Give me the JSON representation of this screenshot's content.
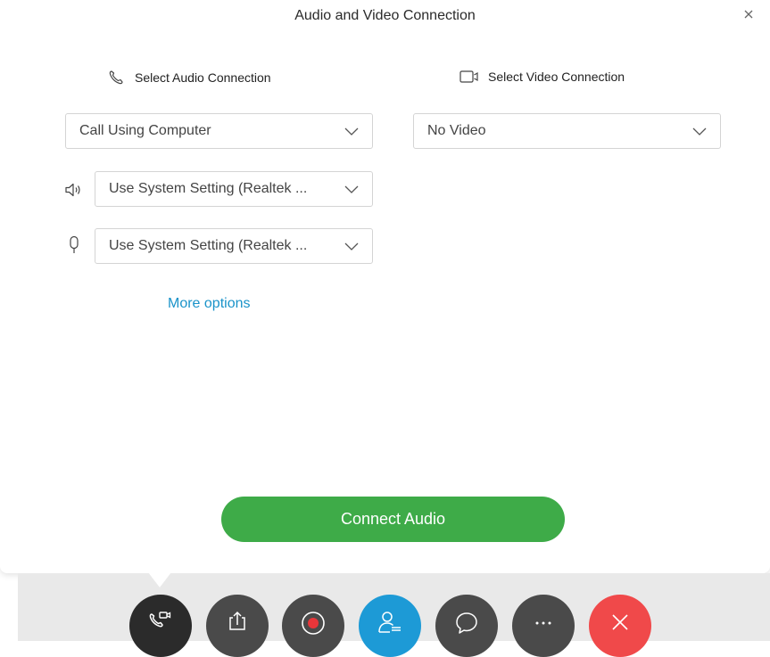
{
  "dialog": {
    "title": "Audio and Video Connection"
  },
  "audio": {
    "heading": "Select Audio Connection",
    "connection_value": "Call Using Computer",
    "speaker_value": "Use System Setting (Realtek ...",
    "microphone_value": "Use System Setting (Realtek ...",
    "more_options_label": "More options"
  },
  "video": {
    "heading": "Select Video Connection",
    "connection_value": "No Video"
  },
  "actions": {
    "connect_label": "Connect Audio"
  },
  "toolbar": {
    "buttons": [
      {
        "name": "audio-video-button",
        "icon": "phone-video-icon",
        "color": "#2b2b2b"
      },
      {
        "name": "share-button",
        "icon": "share-icon",
        "color": "#4a4a4a"
      },
      {
        "name": "record-button",
        "icon": "record-icon",
        "color": "#4a4a4a"
      },
      {
        "name": "participants-button",
        "icon": "participants-icon",
        "color": "#1d9ad6"
      },
      {
        "name": "chat-button",
        "icon": "chat-bubble-icon",
        "color": "#4a4a4a"
      },
      {
        "name": "more-button",
        "icon": "ellipsis-icon",
        "color": "#4a4a4a"
      },
      {
        "name": "end-meeting-button",
        "icon": "close-icon",
        "color": "#f0494a"
      }
    ]
  },
  "colors": {
    "accent": "#3eab48",
    "link": "#1a93c9",
    "record_dot": "#e8363a"
  }
}
